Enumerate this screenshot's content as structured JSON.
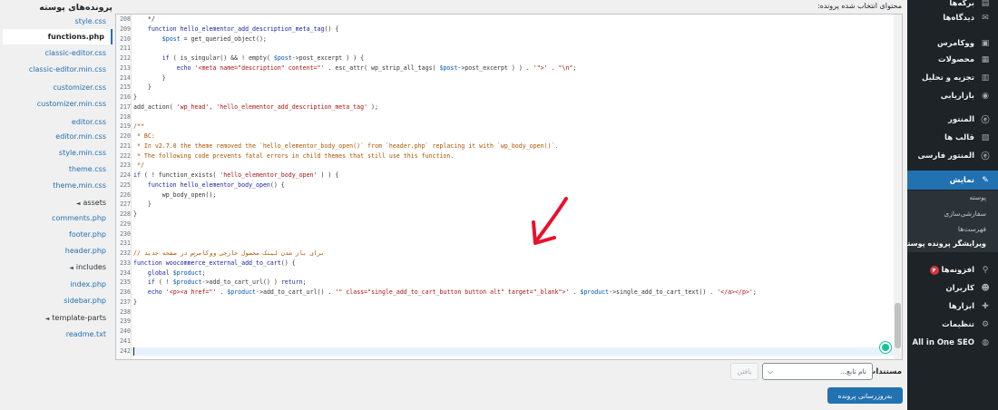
{
  "header": {
    "content_label": "محتوای انتخاب شده پرونده:",
    "files_title": "پرونده‌های پوسته"
  },
  "files": [
    {
      "name": "style.css",
      "kind": "file",
      "current": false
    },
    {
      "name": "functions.php",
      "kind": "file",
      "current": true
    },
    {
      "name": "classic-editor.css",
      "kind": "file",
      "current": false
    },
    {
      "name": "classic-editor.min.css",
      "kind": "file",
      "current": false
    },
    {
      "name": "customizer.css",
      "kind": "file",
      "current": false
    },
    {
      "name": "customizer.min.css",
      "kind": "file",
      "current": false
    },
    {
      "name": "editor.css",
      "kind": "file",
      "current": false
    },
    {
      "name": "editor.min.css",
      "kind": "file",
      "current": false
    },
    {
      "name": "style.min.css",
      "kind": "file",
      "current": false
    },
    {
      "name": "theme.css",
      "kind": "file",
      "current": false
    },
    {
      "name": "theme.min.css",
      "kind": "file",
      "current": false
    },
    {
      "name": "assets",
      "kind": "folder",
      "current": false
    },
    {
      "name": "comments.php",
      "kind": "file",
      "current": false
    },
    {
      "name": "footer.php",
      "kind": "file",
      "current": false
    },
    {
      "name": "header.php",
      "kind": "file",
      "current": false
    },
    {
      "name": "includes",
      "kind": "folder",
      "current": false
    },
    {
      "name": "index.php",
      "kind": "file",
      "current": false
    },
    {
      "name": "sidebar.php",
      "kind": "file",
      "current": false
    },
    {
      "name": "template-parts",
      "kind": "folder",
      "current": false
    },
    {
      "name": "readme.txt",
      "kind": "file",
      "current": false
    }
  ],
  "folder_arrow": "◄",
  "code": {
    "first_line": 208,
    "lines": [
      [
        [
          "op",
          "    */"
        ]
      ],
      [
        [
          "op",
          "    "
        ],
        [
          "kw",
          "function"
        ],
        [
          "op",
          " "
        ],
        [
          "fn",
          "hello_elementor_add_description_meta_tag"
        ],
        [
          "op",
          "() {"
        ]
      ],
      [
        [
          "op",
          "        "
        ],
        [
          "var",
          "$post"
        ],
        [
          "op",
          " = get_queried_object();"
        ]
      ],
      [
        [
          "op",
          ""
        ]
      ],
      [
        [
          "op",
          "        "
        ],
        [
          "kw",
          "if"
        ],
        [
          "op",
          " ( is_singular() && ! empty( "
        ],
        [
          "var",
          "$post"
        ],
        [
          "op",
          "->post_excerpt ) ) {"
        ]
      ],
      [
        [
          "op",
          "            "
        ],
        [
          "kw",
          "echo"
        ],
        [
          "op",
          " "
        ],
        [
          "str",
          "'<meta name=\"description\" content=\"'"
        ],
        [
          "op",
          " . esc_attr( wp_strip_all_tags( "
        ],
        [
          "var",
          "$post"
        ],
        [
          "op",
          "->post_excerpt ) ) . "
        ],
        [
          "str",
          "'\">'"
        ],
        [
          "op",
          " . "
        ],
        [
          "str",
          "\"\\n\""
        ],
        [
          "op",
          ";"
        ]
      ],
      [
        [
          "op",
          "        }"
        ]
      ],
      [
        [
          "op",
          "    }"
        ]
      ],
      [
        [
          "op",
          "}"
        ]
      ],
      [
        [
          "op",
          "add_action( "
        ],
        [
          "str",
          "'wp_head'"
        ],
        [
          "op",
          ", "
        ],
        [
          "str",
          "'hello_elementor_add_description_meta_tag'"
        ],
        [
          "op",
          " );"
        ]
      ],
      [
        [
          "op",
          ""
        ]
      ],
      [
        [
          "cm",
          "/**"
        ]
      ],
      [
        [
          "cm",
          " * BC:"
        ]
      ],
      [
        [
          "cm",
          " * In v2.7.0 the theme removed the `hello_elementor_body_open()` from `header.php` replacing it with `wp_body_open()`."
        ]
      ],
      [
        [
          "cm",
          " * The following code prevents fatal errors in child themes that still use this function."
        ]
      ],
      [
        [
          "cm",
          " */"
        ]
      ],
      [
        [
          "kw",
          "if"
        ],
        [
          "op",
          " ( ! function_exists( "
        ],
        [
          "str",
          "'hello_elementor_body_open'"
        ],
        [
          "op",
          " ) ) {"
        ]
      ],
      [
        [
          "op",
          "    "
        ],
        [
          "kw",
          "function"
        ],
        [
          "op",
          " "
        ],
        [
          "fn",
          "hello_elementor_body_open"
        ],
        [
          "op",
          "() {"
        ]
      ],
      [
        [
          "op",
          "        wp_body_open();"
        ]
      ],
      [
        [
          "op",
          "    }"
        ]
      ],
      [
        [
          "op",
          "}"
        ]
      ],
      [
        [
          "op",
          ""
        ]
      ],
      [
        [
          "op",
          ""
        ]
      ],
      [
        [
          "op",
          ""
        ]
      ],
      [
        [
          "cm",
          "// برای باز شدن لینک محصول خارجی ووکامرس در صفحه جدید"
        ]
      ],
      [
        [
          "kw",
          "function"
        ],
        [
          "op",
          " "
        ],
        [
          "fn",
          "woocommerce_external_add_to_cart"
        ],
        [
          "op",
          "() {"
        ]
      ],
      [
        [
          "op",
          "    "
        ],
        [
          "kw",
          "global"
        ],
        [
          "op",
          " "
        ],
        [
          "var",
          "$product"
        ],
        [
          "op",
          ";"
        ]
      ],
      [
        [
          "op",
          "    "
        ],
        [
          "kw",
          "if"
        ],
        [
          "op",
          " ( ! "
        ],
        [
          "var",
          "$product"
        ],
        [
          "op",
          "->add_to_cart_url() ) "
        ],
        [
          "kw",
          "return"
        ],
        [
          "op",
          ";"
        ]
      ],
      [
        [
          "op",
          "    "
        ],
        [
          "kw",
          "echo"
        ],
        [
          "op",
          " "
        ],
        [
          "str",
          "'<p><a href=\"'"
        ],
        [
          "op",
          " . "
        ],
        [
          "var",
          "$product"
        ],
        [
          "op",
          "->add_to_cart_url() . "
        ],
        [
          "str",
          "'\" class=\"single_add_to_cart_button button alt\" target=\"_blank\">'"
        ],
        [
          "op",
          " . "
        ],
        [
          "var",
          "$product"
        ],
        [
          "op",
          "->single_add_to_cart_text() . "
        ],
        [
          "str",
          "'</a></p>'"
        ],
        [
          "op",
          ";"
        ]
      ],
      [
        [
          "op",
          "}"
        ]
      ],
      [
        [
          "op",
          ""
        ]
      ],
      [
        [
          "op",
          ""
        ]
      ],
      [
        [
          "op",
          ""
        ]
      ],
      [
        [
          "op",
          ""
        ]
      ],
      [
        [
          "op",
          ""
        ]
      ]
    ]
  },
  "sidebar": {
    "items": [
      {
        "label": "برگه‌ها",
        "icon": "pages-icon",
        "glyph": "▤"
      },
      {
        "label": "دیدگاه‌ها",
        "icon": "comments-icon",
        "glyph": "✉"
      },
      {
        "label": "ووکامرس",
        "icon": "woocommerce-icon",
        "glyph": "▣"
      },
      {
        "label": "محصولات",
        "icon": "products-icon",
        "glyph": "▦"
      },
      {
        "label": "تجزیه و تحلیل",
        "icon": "analytics-icon",
        "glyph": "▥"
      },
      {
        "label": "بازاریابی",
        "icon": "marketing-icon",
        "glyph": "◉"
      },
      {
        "label": "المنتور",
        "icon": "elementor-icon",
        "glyph": "ⓔ"
      },
      {
        "label": "قالب ها",
        "icon": "templates-icon",
        "glyph": "▧"
      },
      {
        "label": "المنتور فارسی",
        "icon": "elementor-persian-icon",
        "glyph": "ⓔ"
      },
      {
        "label": "نمایش",
        "icon": "appearance-icon",
        "glyph": "✎"
      },
      {
        "label": "افزونه‌ها",
        "icon": "plugins-icon",
        "glyph": "⚲"
      },
      {
        "label": "کاربران",
        "icon": "users-icon",
        "glyph": "☻"
      },
      {
        "label": "ابزارها",
        "icon": "tools-icon",
        "glyph": "✚"
      },
      {
        "label": "تنظیمات",
        "icon": "settings-icon",
        "glyph": "⚙"
      },
      {
        "label": "All in One SEO",
        "icon": "seo-icon",
        "glyph": "◍"
      }
    ],
    "submenu": [
      "پوسته",
      "سفارشی‌سازی",
      "فهرست‌ها",
      "ویرایشگر پرونده پوسته"
    ],
    "plugins_badge": "۴"
  },
  "footer": {
    "doc_label": "مستندات:",
    "select_placeholder": "نام تابع...",
    "select_chevron": "⌵",
    "lookup_label": "یافتن",
    "update_label": "به‌روزرسانی پرونده"
  }
}
